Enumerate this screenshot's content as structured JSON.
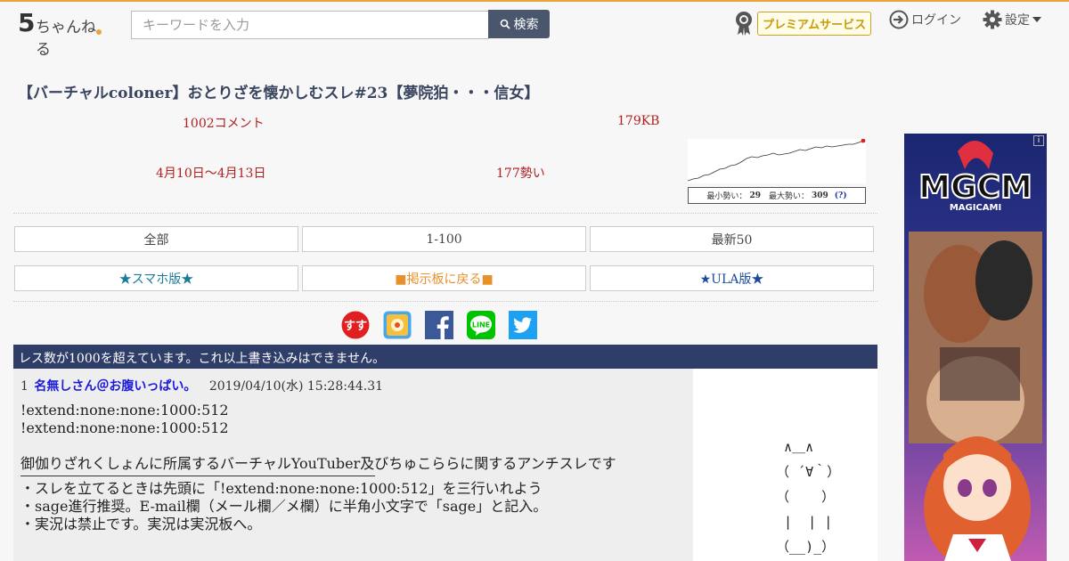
{
  "header": {
    "logo_text": "ちゃんねる",
    "logo_digit": "5",
    "search": {
      "placeholder": "キーワードを入力",
      "button_label": "検索"
    },
    "premium_label": "プレミアムサービス",
    "login_label": "ログイン",
    "settings_label": "設定"
  },
  "thread": {
    "title": "【バーチャルcoloner】おとりざを懐かしむスレ#23【夢院狛・・・信女】",
    "comments": "1002コメント",
    "size": "179KB",
    "period": "4月10日〜4月13日",
    "momentum": "177勢い",
    "spark": {
      "min_label": "最小勢い：",
      "min_value": "29",
      "max_label": "最大勢い：",
      "max_value": "309",
      "help": "(?)"
    }
  },
  "nav": {
    "row1": [
      "全部",
      "1-100",
      "最新50"
    ],
    "row2": [
      "★スマホ版★",
      "■掲示板に戻る■",
      "★ULA版★"
    ]
  },
  "social": [
    "sure-icon",
    "matome-icon",
    "facebook-icon",
    "line-icon",
    "twitter-icon"
  ],
  "social_line_label": "LINE",
  "notice": "レス数が1000を超えています。これ以上書き込みはできません。",
  "post": {
    "number": "1",
    "author": "名無しさん＠お腹いっぱい。",
    "date": "2019/04/10(水) 15:28:44.31",
    "lines": [
      "!extend:none:none:1000:512",
      "!extend:none:none:1000:512",
      "",
      "御伽りざれくしょんに所属するバーチャルYouTuber及びちゅこららに関するアンチスレです"
    ],
    "lines_after_rule": [
      "・スレを立てるときは先頭に「!extend:none:none:1000:512」を三行いれよう",
      "・sage進行推奨。E-mail欄（メール欄／メ欄）に半角小文字で「sage」と記入。",
      "・実況は禁止です。実況は実況板へ。"
    ]
  },
  "ascii_art": "  ∧＿∧\n （ ´∀｀）\n （    ）\n  |  | |\n （__)_）",
  "ad": {
    "title": "MGCM",
    "subtitle": "MAGICAMI",
    "info": "i"
  },
  "colors": {
    "accent_orange": "#e8a33a",
    "notice_bg": "#2f3e68",
    "stat_red": "#b02020",
    "author_blue": "#1a1add"
  }
}
